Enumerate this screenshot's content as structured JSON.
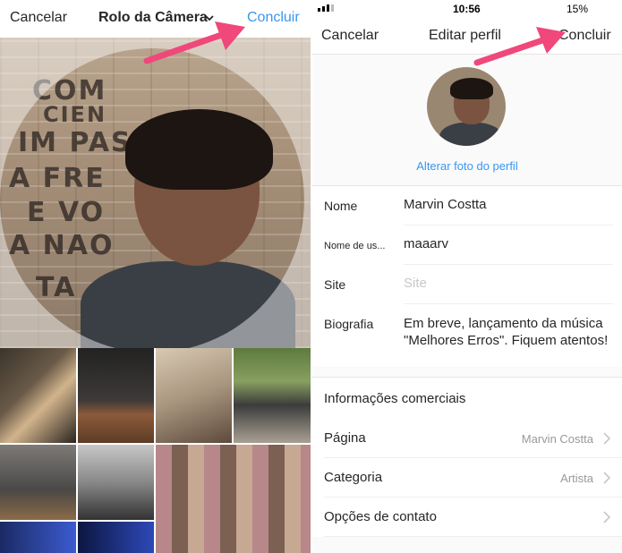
{
  "left": {
    "cancel_label": "Cancelar",
    "title": "Rolo da Câmera",
    "done_label": "Concluir",
    "graffiti": [
      "COM",
      "CIEN",
      "IM PAS",
      "A FRE",
      "E VO",
      "A NAO",
      "TA"
    ]
  },
  "right": {
    "status": {
      "time": "10:56",
      "battery": "15%"
    },
    "header": {
      "cancel_label": "Cancelar",
      "title": "Editar perfil",
      "done_label": "Concluir"
    },
    "change_photo_label": "Alterar foto do perfil",
    "fields": {
      "name_label": "Nome",
      "name_value": "Marvin Costta",
      "username_label": "Nome de us...",
      "username_value": "maaarv",
      "site_label": "Site",
      "site_placeholder": "Site",
      "bio_label": "Biografia",
      "bio_value": "Em breve, lançamento da música \"Melhores Erros\". Fiquem atentos!"
    },
    "business_section_title": "Informações comerciais",
    "business_items": [
      {
        "label": "Página",
        "value": "Marvin Costta"
      },
      {
        "label": "Categoria",
        "value": "Artista"
      },
      {
        "label": "Opções de contato",
        "value": ""
      }
    ]
  },
  "colors": {
    "accent": "#3897f0",
    "arrow": "#f0487a"
  }
}
